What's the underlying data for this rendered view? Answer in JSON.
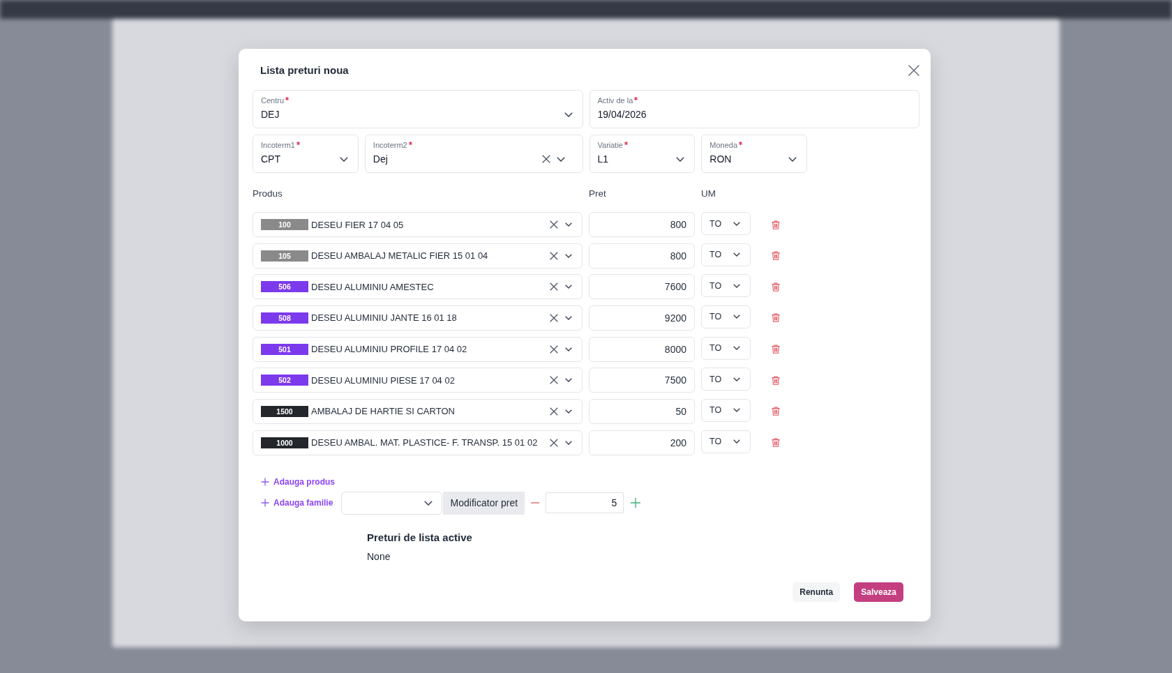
{
  "dialog": {
    "title": "Lista preturi noua"
  },
  "fields": [
    {
      "label": "Centru",
      "required": true,
      "value": "DEJ",
      "kind": "select",
      "clearable": false
    },
    {
      "label": "Activ de la",
      "required": true,
      "value": "19/04/2026",
      "kind": "date",
      "clearable": false
    },
    {
      "label": "Incoterm1",
      "required": true,
      "value": "CPT",
      "kind": "select",
      "clearable": false
    },
    {
      "label": "Incoterm2",
      "required": true,
      "value": "Dej",
      "kind": "select",
      "clearable": true
    },
    {
      "label": "Variatie",
      "required": true,
      "value": "L1",
      "kind": "select",
      "clearable": false
    },
    {
      "label": "Moneda",
      "required": true,
      "value": "RON",
      "kind": "select",
      "clearable": false
    }
  ],
  "products": {
    "columns": [
      "Produs",
      "Pret",
      "UM"
    ],
    "rows": [
      {
        "code": "100",
        "color": "#8a8a8a",
        "name": "DESEU FIER 17 04 05",
        "price": "800",
        "unit": "TO"
      },
      {
        "code": "105",
        "color": "#8a8a8a",
        "name": "DESEU AMBALAJ METALIC FIER 15 01 04",
        "price": "800",
        "unit": "TO"
      },
      {
        "code": "506",
        "color": "#7c3aed",
        "name": "DESEU ALUMINIU AMESTEC",
        "price": "7600",
        "unit": "TO"
      },
      {
        "code": "508",
        "color": "#7c3aed",
        "name": "DESEU ALUMINIU JANTE 16 01 18",
        "price": "9200",
        "unit": "TO"
      },
      {
        "code": "501",
        "color": "#7c3aed",
        "name": "DESEU ALUMINIU PROFILE 17 04 02",
        "price": "8000",
        "unit": "TO"
      },
      {
        "code": "502",
        "color": "#7c3aed",
        "name": "DESEU ALUMINIU PIESE 17 04 02",
        "price": "7500",
        "unit": "TO"
      },
      {
        "code": "1500",
        "color": "#23262b",
        "name": "AMBALAJ DE HARTIE SI CARTON",
        "price": "50",
        "unit": "TO"
      },
      {
        "code": "1000",
        "color": "#23262b",
        "name": "DESEU AMBAL. MAT. PLASTICE- F. TRANSP. 15 01 02",
        "price": "200",
        "unit": "TO"
      }
    ]
  },
  "add_product": {
    "label": "Adauga produs"
  },
  "add_family": {
    "label": "Adauga familie"
  },
  "price_modifier": {
    "label": "Modificator pret",
    "value": "5"
  },
  "active_prices": {
    "title": "Preturi de lista active",
    "value": "None"
  },
  "buttons": [
    {
      "label": "Renunta",
      "kind": "secondary"
    },
    {
      "label": "Salveaza",
      "kind": "primary"
    }
  ]
}
